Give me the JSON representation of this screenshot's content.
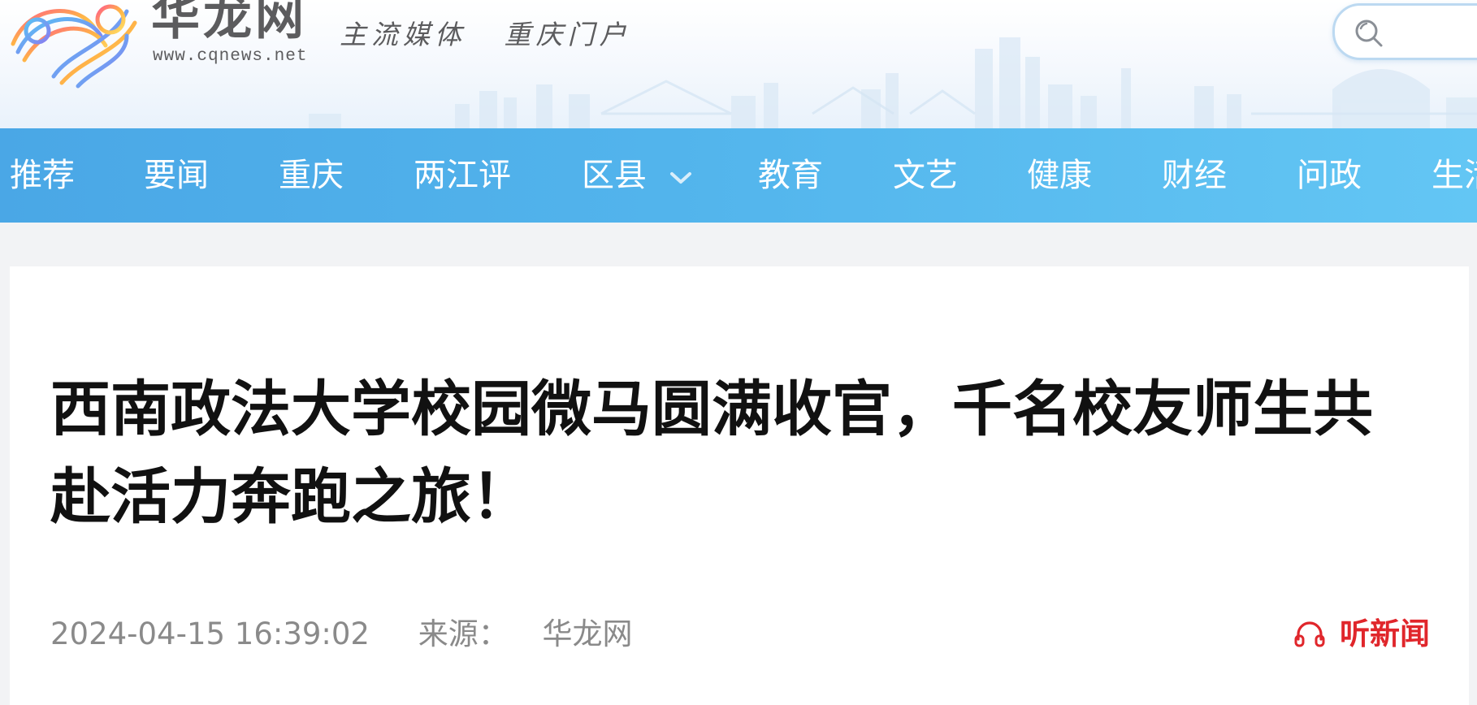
{
  "header": {
    "logo_text": "华龙网",
    "logo_url": "www.cqnews.net",
    "slogan_1": "主流媒体",
    "slogan_2": "重庆门户",
    "search_icon": "search-icon"
  },
  "nav": {
    "items": [
      {
        "label": "推荐"
      },
      {
        "label": "要闻"
      },
      {
        "label": "重庆"
      },
      {
        "label": "两江评"
      },
      {
        "label": "区县",
        "has_dropdown": true
      },
      {
        "label": "教育"
      },
      {
        "label": "文艺"
      },
      {
        "label": "健康"
      },
      {
        "label": "财经"
      },
      {
        "label": "问政"
      },
      {
        "label": "生活"
      }
    ]
  },
  "article": {
    "title": "西南政法大学校园微马圆满收官，千名校友师生共赴活力奔跑之旅！",
    "datetime": "2024-04-15 16:39:02",
    "source_label": "来源：",
    "source_value": "华龙网",
    "listen_label": "听新闻",
    "listen_icon": "headphone-icon"
  },
  "colors": {
    "nav_bg": "#52b4ec",
    "title": "#111111",
    "meta": "#8a8a8a",
    "listen": "#e0262b",
    "logo_gray": "#5c5c5e"
  }
}
